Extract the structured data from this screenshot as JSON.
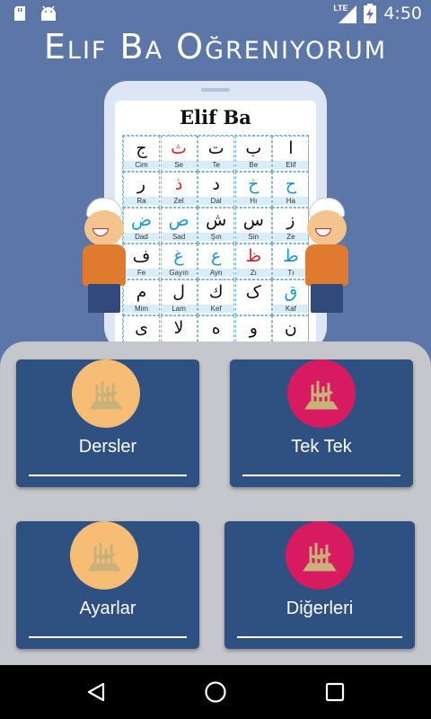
{
  "status_bar": {
    "network": "LTE",
    "time": "4:50"
  },
  "app": {
    "title": "Elif Ba Oğreniyorum"
  },
  "illustration": {
    "sheet_title": "Elif Ba",
    "rows": [
      [
        {
          "ar": "ج",
          "name": "Cim"
        },
        {
          "ar": "ث",
          "name": "Se"
        },
        {
          "ar": "ت",
          "name": "Te"
        },
        {
          "ar": "ب",
          "name": "Be"
        },
        {
          "ar": "ا",
          "name": "Elif"
        }
      ],
      [
        {
          "ar": "ر",
          "name": "Ra"
        },
        {
          "ar": "ذ",
          "name": "Zel"
        },
        {
          "ar": "د",
          "name": "Dal"
        },
        {
          "ar": "خ",
          "name": "Hı"
        },
        {
          "ar": "ح",
          "name": "Ha"
        }
      ],
      [
        {
          "ar": "ض",
          "name": "Dad"
        },
        {
          "ar": "ص",
          "name": "Sad"
        },
        {
          "ar": "ش",
          "name": "Şın"
        },
        {
          "ar": "س",
          "name": "Sin"
        },
        {
          "ar": "ز",
          "name": "Ze"
        }
      ],
      [
        {
          "ar": "ف",
          "name": "Fe"
        },
        {
          "ar": "غ",
          "name": "Gayın"
        },
        {
          "ar": "ع",
          "name": "Ayn"
        },
        {
          "ar": "ظ",
          "name": "Zı"
        },
        {
          "ar": "ط",
          "name": "Tı"
        }
      ],
      [
        {
          "ar": "م",
          "name": "Mim"
        },
        {
          "ar": "ل",
          "name": "Lam"
        },
        {
          "ar": "ك",
          "name": "Kef"
        },
        {
          "ar": "ک",
          "name": ""
        },
        {
          "ar": "ق",
          "name": "Kaf"
        }
      ],
      [
        {
          "ar": "ى",
          "name": ""
        },
        {
          "ar": "لا",
          "name": ""
        },
        {
          "ar": "ه",
          "name": ""
        },
        {
          "ar": "و",
          "name": ""
        },
        {
          "ar": "ن",
          "name": ""
        }
      ]
    ]
  },
  "menu": [
    {
      "label": "Dersler",
      "circle_color": "#f7bd74"
    },
    {
      "label": "Tek Tek",
      "circle_color": "#d81b60"
    },
    {
      "label": "Ayarlar",
      "circle_color": "#f7bd74"
    },
    {
      "label": "Diğerleri",
      "circle_color": "#d81b60"
    }
  ],
  "nav": {
    "back_icon": "back-triangle-icon",
    "home_icon": "home-circle-icon",
    "recents_icon": "recents-square-icon"
  }
}
